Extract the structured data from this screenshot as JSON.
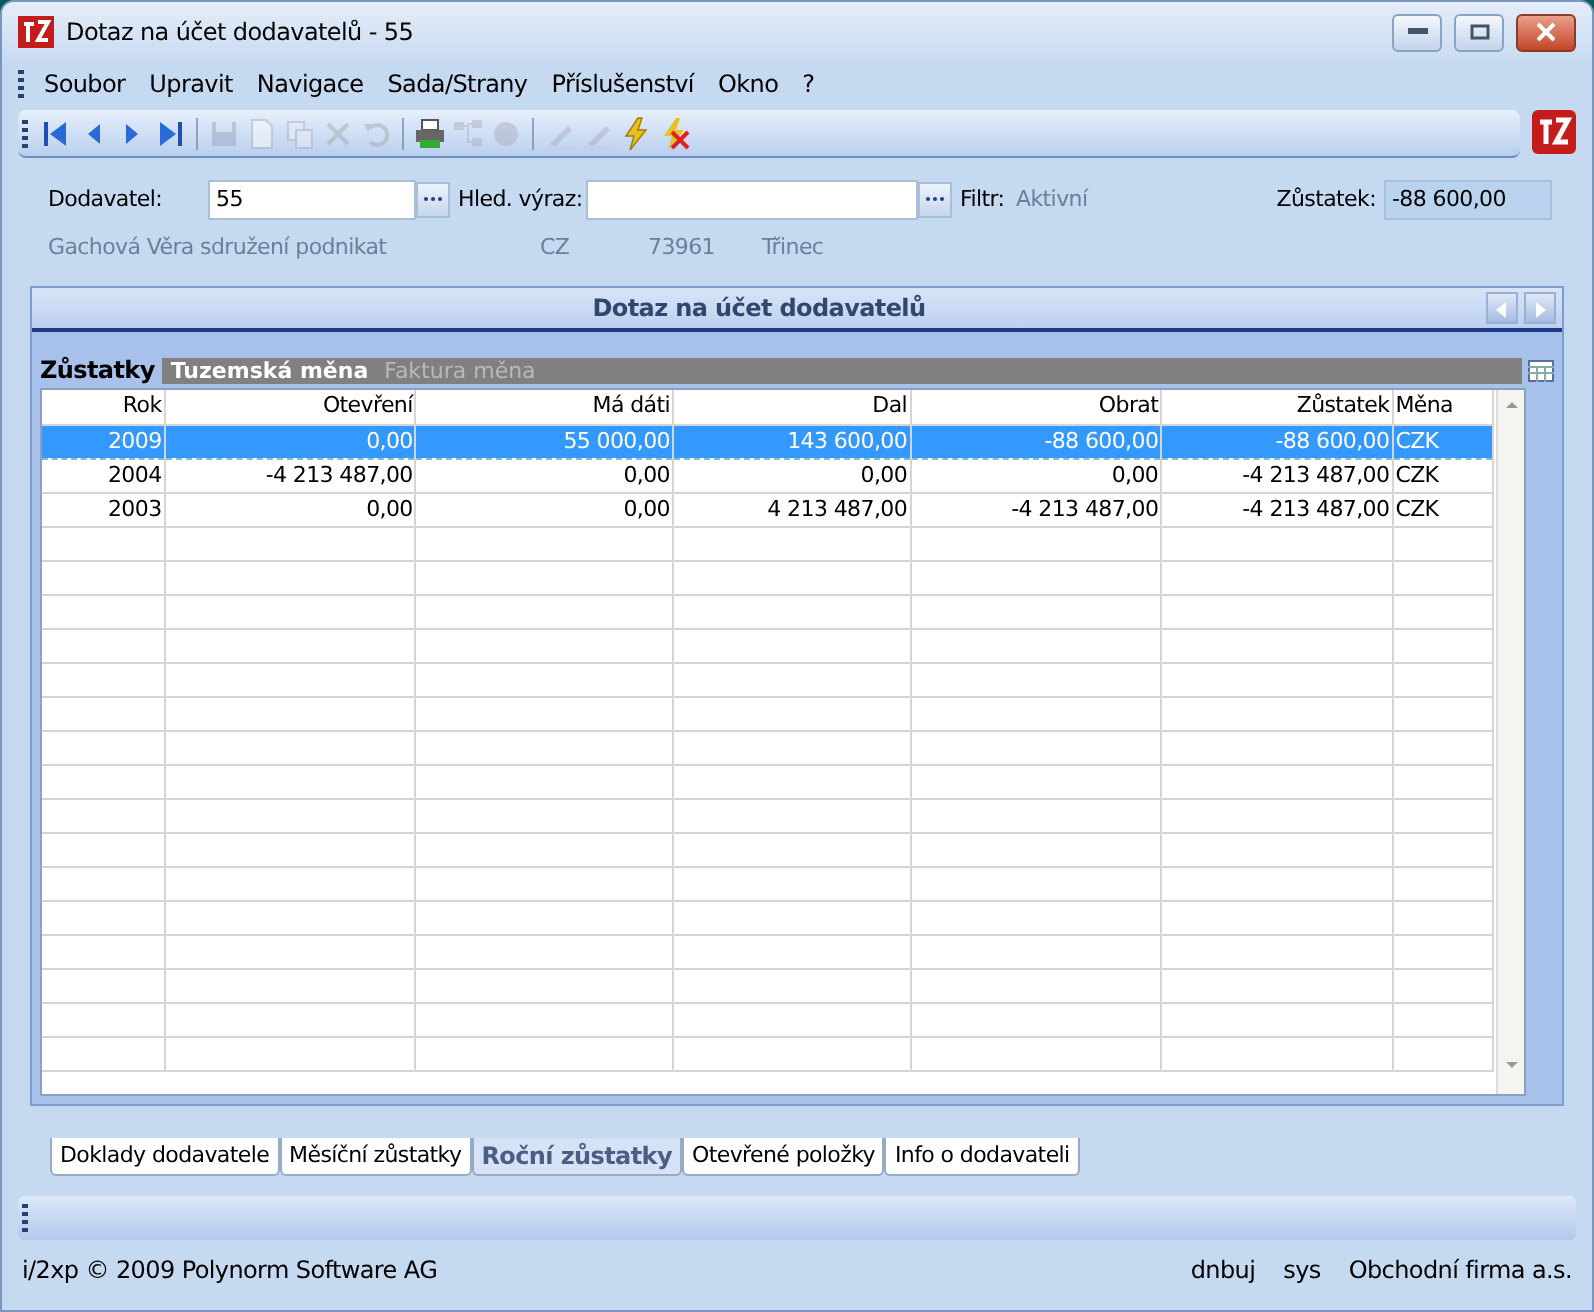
{
  "window": {
    "title": "Dotaz na účet dodavatelů - 55"
  },
  "menu": [
    "Soubor",
    "Upravit",
    "Navigace",
    "Sada/Strany",
    "Příslušenství",
    "Okno",
    "?"
  ],
  "toolbar": [
    [
      {
        "kind": "first",
        "disabled": false
      },
      {
        "kind": "prev",
        "disabled": false
      },
      {
        "kind": "next",
        "disabled": false
      },
      {
        "kind": "last",
        "disabled": false
      }
    ],
    [
      {
        "kind": "save",
        "disabled": true
      },
      {
        "kind": "new",
        "disabled": true
      },
      {
        "kind": "copy",
        "disabled": true
      },
      {
        "kind": "delete",
        "disabled": true
      },
      {
        "kind": "undo",
        "disabled": true
      }
    ],
    [
      {
        "kind": "print",
        "disabled": false
      },
      {
        "kind": "tree",
        "disabled": true
      },
      {
        "kind": "circle",
        "disabled": true
      }
    ],
    [
      {
        "kind": "pen",
        "disabled": true
      },
      {
        "kind": "pen",
        "disabled": true
      },
      {
        "kind": "bolt",
        "disabled": false
      },
      {
        "kind": "bolt-x",
        "disabled": false
      }
    ]
  ],
  "form": {
    "supplier_label": "Dodavatel:",
    "supplier_value": "55",
    "search_label": "Hled. výraz:",
    "filter_label": "Filtr:",
    "filter_value": "Aktivní",
    "balance_label": "Zůstatek:",
    "balance_value": "-88 600,00",
    "supplier_name": "Gachová Věra sdružení podnikat",
    "country": "CZ",
    "zip": "73961",
    "city": "Třinec"
  },
  "panel": {
    "title": "Dotaz na účet dodavatelů",
    "segment_label": "Zůstatky",
    "segments": [
      {
        "label": "Tuzemská měna",
        "selected": true
      },
      {
        "label": "Faktura měna",
        "selected": false
      }
    ],
    "table": {
      "columns": [
        "Rok",
        "Otevření",
        "Má dáti",
        "Dal",
        "Obrat",
        "Zůstatek",
        "Měna"
      ],
      "rows": [
        {
          "cells": [
            "2009",
            "0,00",
            "55 000,00",
            "143 600,00",
            "-88 600,00",
            "-88 600,00",
            "CZK"
          ],
          "selected": true
        },
        {
          "cells": [
            "2004",
            "-4 213 487,00",
            "0,00",
            "0,00",
            "0,00",
            "-4 213 487,00",
            "CZK"
          ],
          "selected": false
        },
        {
          "cells": [
            "2003",
            "0,00",
            "0,00",
            "4 213 487,00",
            "-4 213 487,00",
            "-4 213 487,00",
            "CZK"
          ],
          "selected": false
        }
      ]
    }
  },
  "tabs": [
    {
      "label": "Doklady dodavatele",
      "selected": false
    },
    {
      "label": "Měsíční zůstatky",
      "selected": false
    },
    {
      "label": "Roční zůstatky",
      "selected": true
    },
    {
      "label": "Otevřené položky",
      "selected": false
    },
    {
      "label": "Info o dodavateli",
      "selected": false
    }
  ],
  "status_bar": {
    "left": "i/2xp © 2009 Polynorm Software AG",
    "right": [
      "dnbuj",
      "sys",
      "Obchodní firma a.s."
    ]
  }
}
